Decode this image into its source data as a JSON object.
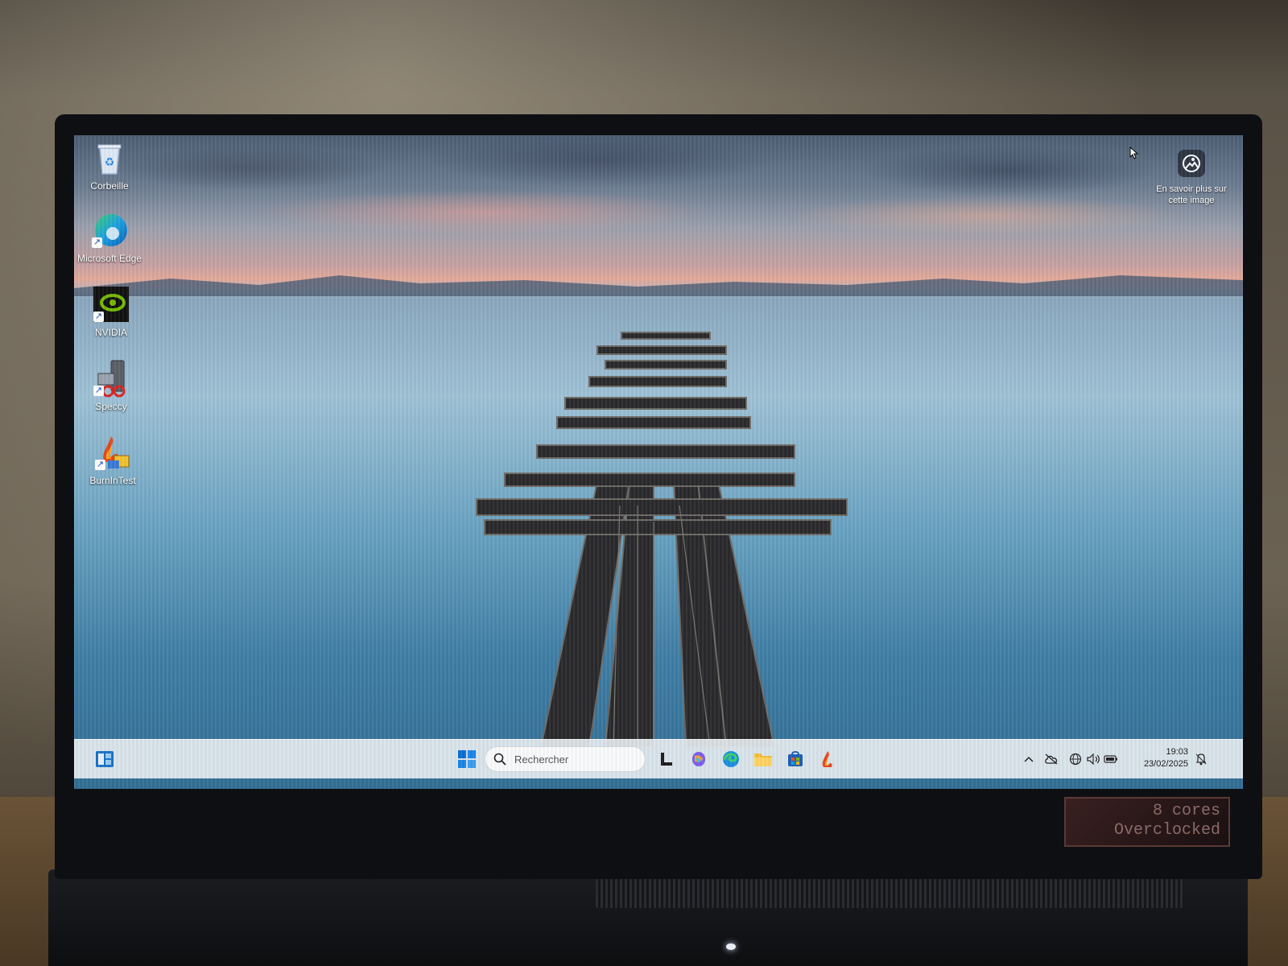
{
  "desktop": {
    "icons": [
      {
        "label": "Corbeille",
        "icon": "recycle-bin-icon"
      },
      {
        "label": "Microsoft Edge",
        "icon": "edge-icon"
      },
      {
        "label": "NVIDIA",
        "icon": "nvidia-icon"
      },
      {
        "label": "Speccy",
        "icon": "speccy-icon"
      },
      {
        "label": "BurnInTest",
        "icon": "burnintest-icon"
      }
    ],
    "learn_more": {
      "label": "En savoir plus sur cette image",
      "icon": "spotlight-camera-icon"
    }
  },
  "taskbar": {
    "search": {
      "placeholder": "Rechercher",
      "value": ""
    },
    "pinned": [
      {
        "name": "widgets",
        "icon": "widgets-icon"
      },
      {
        "name": "start",
        "icon": "windows-start-icon"
      },
      {
        "name": "lasso",
        "icon": "l-app-icon"
      },
      {
        "name": "copilot",
        "icon": "copilot-icon"
      },
      {
        "name": "edge",
        "icon": "edge-icon"
      },
      {
        "name": "file-explorer",
        "icon": "folder-icon"
      },
      {
        "name": "store",
        "icon": "store-icon"
      },
      {
        "name": "burnintest",
        "icon": "burnintest-icon"
      }
    ],
    "tray": {
      "icons": [
        "chevron-up-icon",
        "cloud-off-icon",
        "network-icon",
        "volume-icon",
        "battery-icon",
        "notification-bell-icon"
      ],
      "time": "19:03",
      "date": "23/02/2025"
    }
  },
  "hardware": {
    "sticker_line1": "8 cores",
    "sticker_line2": "Overclocked"
  },
  "colors": {
    "taskbar_bg": "#e8eef2",
    "accent_blue": "#0a6fd6"
  }
}
